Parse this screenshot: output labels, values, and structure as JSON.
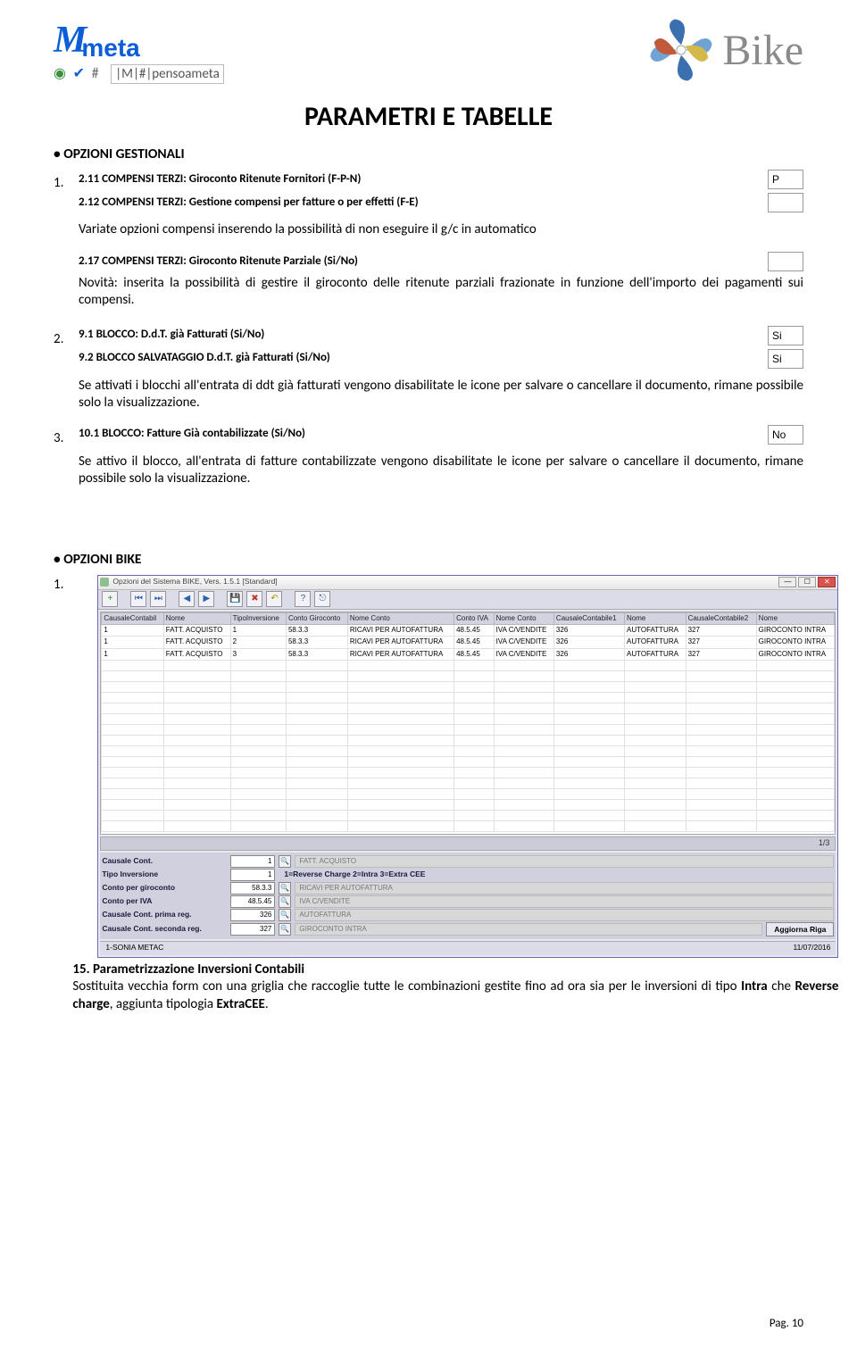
{
  "header": {
    "slogan": "|M|#|pensoameta",
    "bike_brand": "Bike"
  },
  "title": "PARAMETRI E TABELLE",
  "sect_gestionali": "OPZIONI GESTIONALI",
  "sect_bike": "OPZIONI BIKE",
  "fields": {
    "f211": {
      "label": "2.11 COMPENSI TERZI: Giroconto Ritenute Fornitori (F-P-N)",
      "value": "P"
    },
    "f212": {
      "label": "2.12 COMPENSI TERZI: Gestione compensi per fatture o per effetti (F-E)",
      "value": ""
    },
    "f217": {
      "label": "2.17 COMPENSI TERZI: Giroconto Ritenute Parziale (Si/No)",
      "value": ""
    },
    "f91": {
      "label": "9.1 BLOCCO: D.d.T. già Fatturati (Si/No)",
      "value": "Si"
    },
    "f92": {
      "label": "9.2 BLOCCO SALVATAGGIO D.d.T. già Fatturati (Si/No)",
      "value": "Si"
    },
    "f101": {
      "label": "10.1 BLOCCO: Fatture Già contabilizzate (Si/No)",
      "value": "No"
    }
  },
  "texts": {
    "t1a": "Variate opzioni compensi inserendo la possibilità di non eseguire il g/c in automatico",
    "t1b": "Novità: inserita la possibilità di gestire il giroconto delle ritenute parziali frazionate in funzione dell'importo dei pagamenti sui compensi.",
    "t2": "Se attivati i blocchi all'entrata di ddt già fatturati vengono disabilitate le icone per salvare o cancellare il documento, rimane possibile solo la visualizzazione.",
    "t3": "Se attivo il blocco, all'entrata di fatture contabilizzate vengono disabilitate le icone per salvare o cancellare il documento, rimane possibile solo la visualizzazione."
  },
  "bike_win": {
    "title": "Opzioni del Sistema BIKE, Vers. 1.5.1 [Standard]",
    "pager": "1/3",
    "grid_headers": [
      "CausaleContabil",
      "Nome",
      "TipoInversione",
      "Conto Giroconto",
      "Nome Conto",
      "Conto IVA",
      "Nome Conto",
      "CausaleContabile1",
      "Nome",
      "CausaleContabile2",
      "Nome"
    ],
    "rows": [
      [
        "1",
        "FATT. ACQUISTO",
        "1",
        "58.3.3",
        "RICAVI PER AUTOFATTURA",
        "48.5.45",
        "IVA C/VENDITE",
        "326",
        "AUTOFATTURA",
        "327",
        "GIROCONTO INTRA"
      ],
      [
        "1",
        "FATT. ACQUISTO",
        "2",
        "58.3.3",
        "RICAVI PER AUTOFATTURA",
        "48.5.45",
        "IVA C/VENDITE",
        "326",
        "AUTOFATTURA",
        "327",
        "GIROCONTO INTRA"
      ],
      [
        "1",
        "FATT. ACQUISTO",
        "3",
        "58.3.3",
        "RICAVI PER AUTOFATTURA",
        "48.5.45",
        "IVA C/VENDITE",
        "326",
        "AUTOFATTURA",
        "327",
        "GIROCONTO INTRA"
      ]
    ],
    "form": {
      "causale": {
        "label": "Causale Cont.",
        "val": "1",
        "desc": "FATT. ACQUISTO"
      },
      "tipo": {
        "label": "Tipo Inversione",
        "val": "1",
        "hint": "1=Reverse Charge  2=Intra  3=Extra CEE"
      },
      "giroconto": {
        "label": "Conto per giroconto",
        "val": "58.3.3",
        "desc": "RICAVI PER AUTOFATTURA"
      },
      "iva": {
        "label": "Conto per IVA",
        "val": "48.5.45",
        "desc": "IVA C/VENDITE"
      },
      "prima": {
        "label": "Causale Cont. prima reg.",
        "val": "326",
        "desc": "AUTOFATTURA"
      },
      "seconda": {
        "label": "Causale Cont. seconda reg.",
        "val": "327",
        "desc": "GIROCONTO INTRA"
      },
      "btn": "Aggiorna Riga"
    },
    "status_left": "1-SONIA          METAC",
    "status_right": "11/07/2016"
  },
  "bike_item": {
    "num": "1.",
    "title": "15. Parametrizzazione Inversioni Contabili",
    "text": "Sostituita vecchia form con una griglia che raccoglie tutte le combinazioni gestite fino ad ora sia per le inversioni di tipo Intra che Reverse charge, aggiunta tipologia ExtraCEE."
  },
  "page_num": "Pag. 10"
}
